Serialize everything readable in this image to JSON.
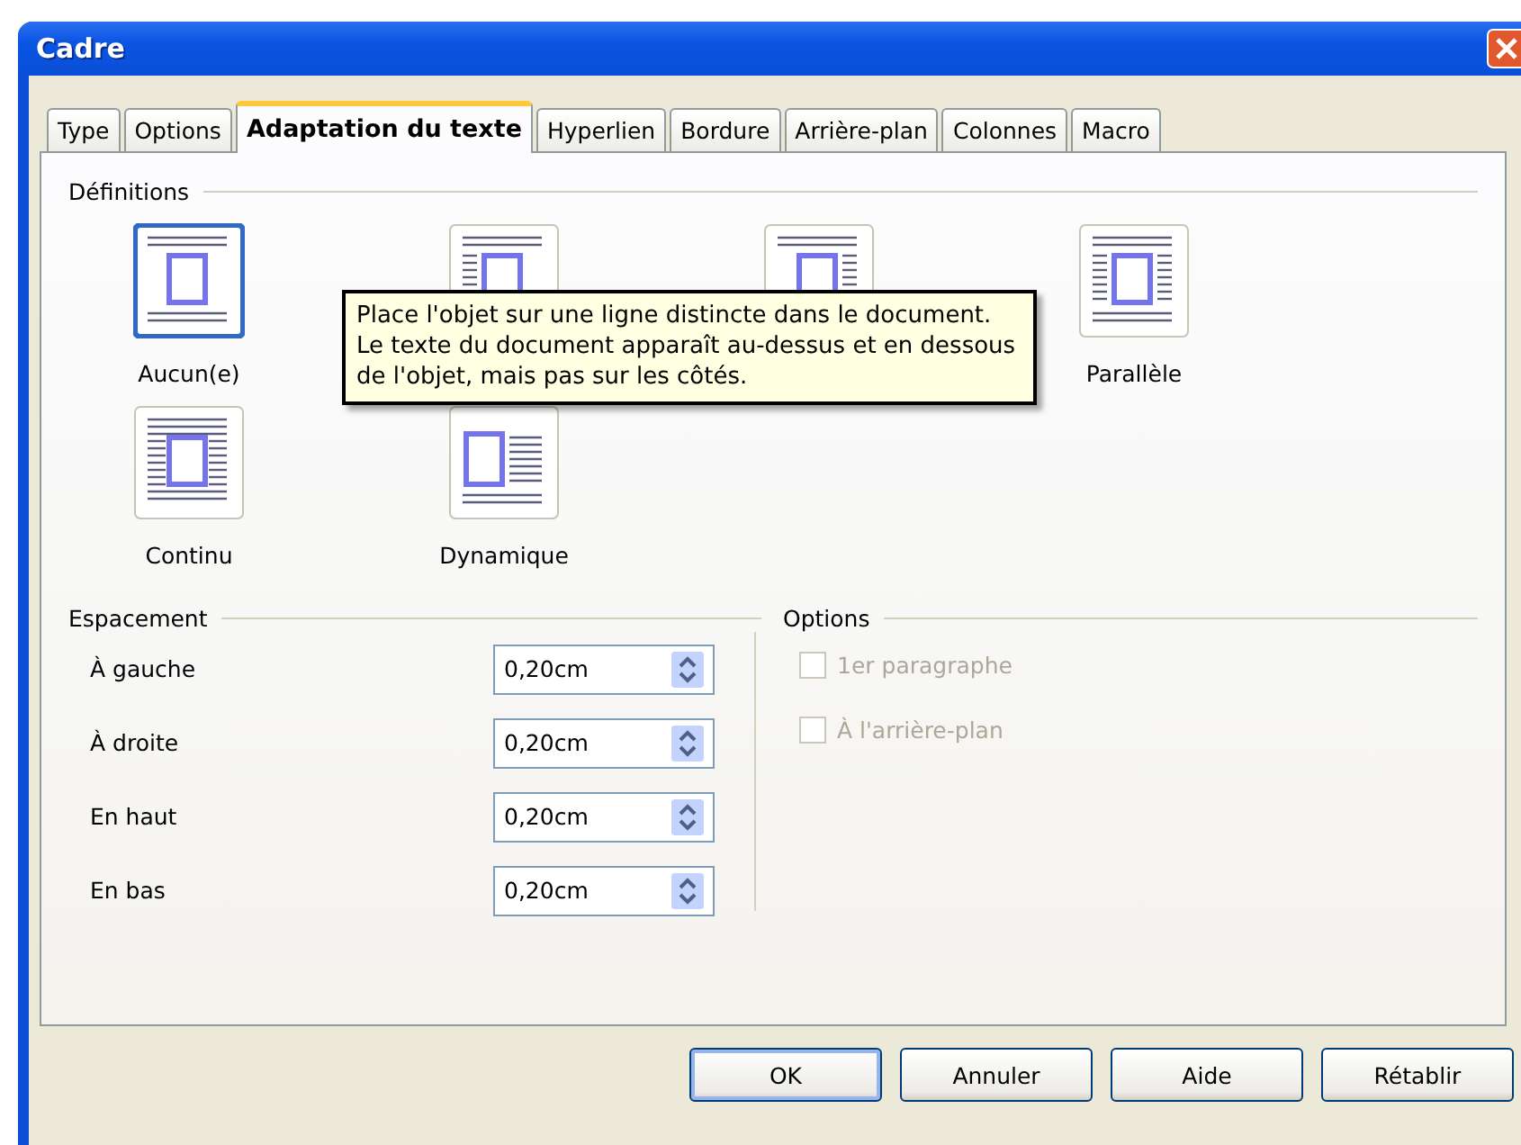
{
  "window": {
    "title": "Cadre"
  },
  "tabs": [
    {
      "label": "Type",
      "selected": false
    },
    {
      "label": "Options",
      "selected": false
    },
    {
      "label": "Adaptation du texte",
      "selected": true
    },
    {
      "label": "Hyperlien",
      "selected": false
    },
    {
      "label": "Bordure",
      "selected": false
    },
    {
      "label": "Arrière-plan",
      "selected": false
    },
    {
      "label": "Colonnes",
      "selected": false
    },
    {
      "label": "Macro",
      "selected": false
    }
  ],
  "definitions": {
    "legend": "Définitions",
    "items": [
      {
        "kind": "none",
        "label": "Aucun(e)",
        "selected": true
      },
      {
        "kind": "before",
        "selected": false
      },
      {
        "kind": "after",
        "selected": false
      },
      {
        "kind": "parallel",
        "label": "Parallèle",
        "selected": false
      },
      {
        "kind": "through",
        "label": "Continu",
        "selected": false
      },
      {
        "kind": "optimal",
        "label": "Dynamique",
        "selected": false
      }
    ]
  },
  "tooltip": {
    "text": "Place l'objet sur une ligne distincte dans le document. Le texte du document apparaît au-dessus et en dessous de l'objet, mais pas sur les côtés."
  },
  "spacing": {
    "legend": "Espacement",
    "fields": [
      {
        "label": "À gauche",
        "value": "0,20cm"
      },
      {
        "label": "À droite",
        "value": "0,20cm"
      },
      {
        "label": "En haut",
        "value": "0,20cm"
      },
      {
        "label": "En bas",
        "value": "0,20cm"
      }
    ]
  },
  "options": {
    "legend": "Options",
    "checkboxes": [
      {
        "label": "1er paragraphe",
        "checked": false,
        "disabled": true
      },
      {
        "label": "À l'arrière-plan",
        "checked": false,
        "disabled": true
      }
    ]
  },
  "buttons": [
    {
      "label": "OK",
      "default": true
    },
    {
      "label": "Annuler",
      "default": false
    },
    {
      "label": "Aide",
      "default": false
    },
    {
      "label": "Rétablir",
      "default": false
    }
  ]
}
